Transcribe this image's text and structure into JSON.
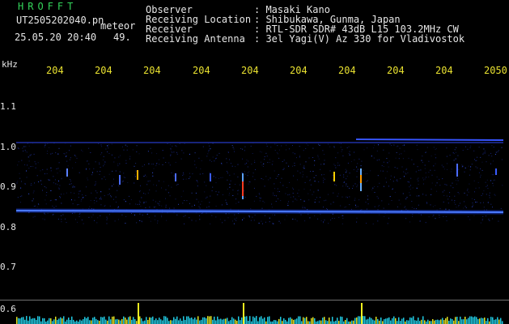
{
  "header": {
    "station_title": "HROFFT",
    "file_name": "UT2505202040.pn",
    "meteor_label": "meteor",
    "date_time": "25.05.20 20:40",
    "meteor_count": "49."
  },
  "info": [
    {
      "label": "Observer",
      "value": ": Masaki Kano"
    },
    {
      "label": "Receiving Location",
      "value": ": Shibukawa, Gunma, Japan"
    },
    {
      "label": "Receiver",
      "value": ": RTL-SDR SDR# 43dB L15 103.2MHz CW"
    },
    {
      "label": "Receiving Antenna",
      "value": ": 3el Yagi(V) Az 330 for Vladivostok"
    }
  ],
  "axes": {
    "y_unit": "kHz",
    "y_ticks": [
      "1.1",
      "1.0",
      "0.9",
      "0.8",
      "0.7",
      "0.6"
    ],
    "x_ticks": [
      "204",
      "204",
      "204",
      "204",
      "204",
      "204",
      "204",
      "204",
      "204",
      "2050"
    ]
  },
  "colors": {
    "background": "#000000",
    "title": "#33d35a",
    "text": "#e6e6e6",
    "time_ticks": "#e8e030",
    "signal": "#2a4cff",
    "bottom_bar": "#20c8e0"
  }
}
